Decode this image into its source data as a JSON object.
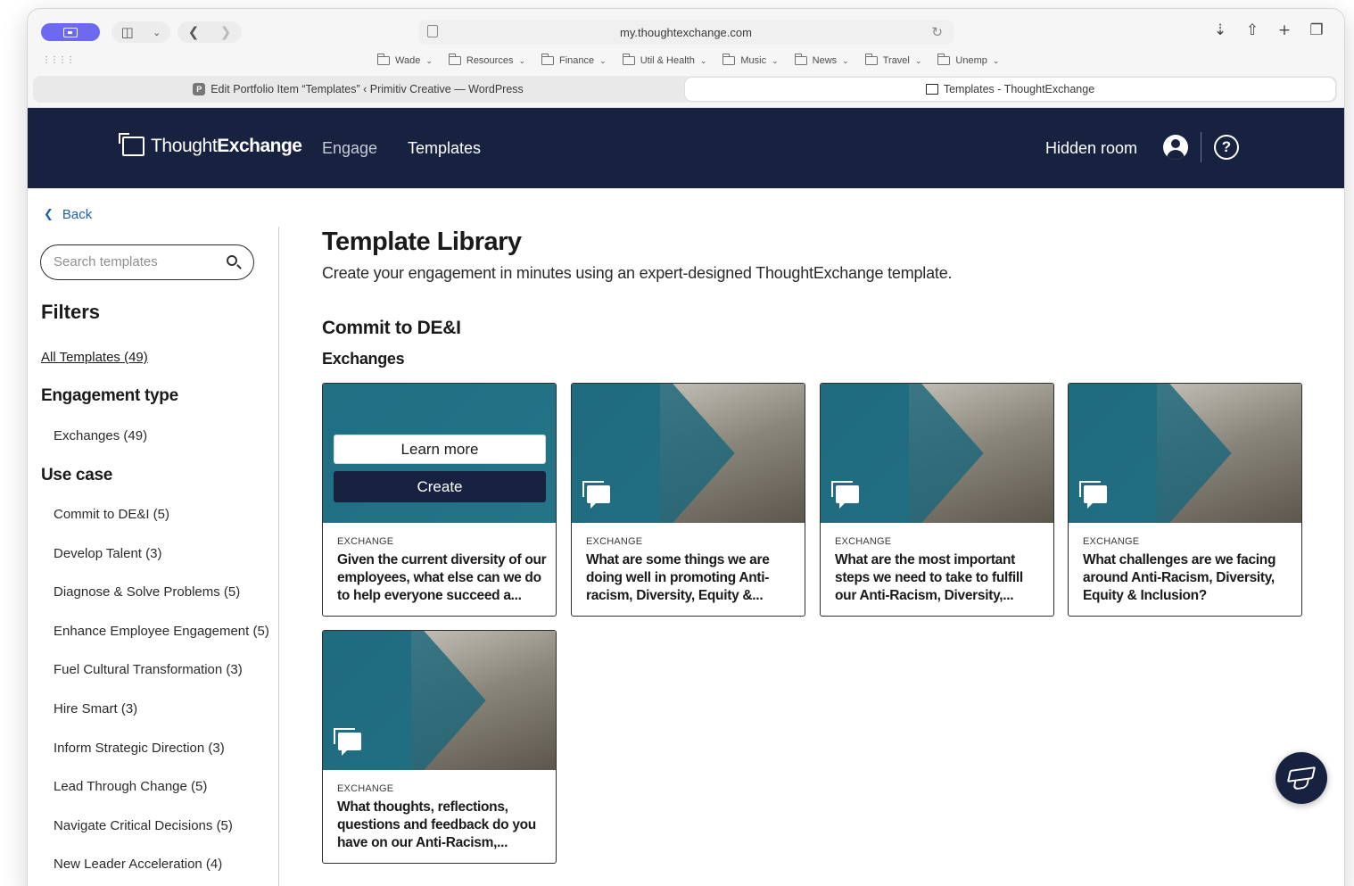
{
  "browser": {
    "url": "my.thoughtexchange.com",
    "bookmarks": [
      "Wade",
      "Resources",
      "Finance",
      "Util & Health",
      "Music",
      "News",
      "Travel",
      "Unemp"
    ],
    "tabs": [
      {
        "title": "Edit Portfolio Item “Templates” ‹ Primitiv Creative — WordPress",
        "favicon": "P"
      },
      {
        "title": "Templates - ThoughtExchange",
        "favicon": ""
      }
    ]
  },
  "header": {
    "logo_thin": "Thought",
    "logo_bold": "Exchange",
    "nav_engage": "Engage",
    "nav_templates": "Templates",
    "room": "Hidden room",
    "help": "?"
  },
  "sidebar": {
    "back": "Back",
    "search_placeholder": "Search templates",
    "filters_title": "Filters",
    "all_templates": "All Templates (49)",
    "engagement_type_title": "Engagement type",
    "engagement_types": [
      "Exchanges (49)"
    ],
    "use_case_title": "Use case",
    "use_cases": [
      "Commit to DE&I  (5)",
      "Develop Talent  (3)",
      "Diagnose & Solve Problems  (5)",
      "Enhance Employee Engagement  (5)",
      "Fuel Cultural Transformation  (3)",
      "Hire Smart  (3)",
      "Inform Strategic Direction  (3)",
      "Lead Through Change  (5)",
      "Navigate Critical Decisions  (5)",
      "New Leader Acceleration  (4)"
    ]
  },
  "main": {
    "title": "Template Library",
    "subtitle": "Create your engagement in minutes using an expert-designed ThoughtExchange template.",
    "section_title": "Commit to DE&I",
    "section_subtitle": "Exchanges",
    "learn_more": "Learn more",
    "create": "Create",
    "cards": [
      {
        "kind": "EXCHANGE",
        "question": "Given the current diversity of our employees, what else can we do to help everyone succeed a..."
      },
      {
        "kind": "EXCHANGE",
        "question": "What are some things we are doing well in promoting Anti-racism, Diversity, Equity &..."
      },
      {
        "kind": "EXCHANGE",
        "question": "What are the most important steps we need to take to fulfill our Anti-Racism, Diversity,..."
      },
      {
        "kind": "EXCHANGE",
        "question": "What challenges are we facing around Anti-Racism, Diversity, Equity & Inclusion?"
      },
      {
        "kind": "EXCHANGE",
        "question": "What thoughts, reflections, questions and feedback do you have on our Anti-Racism,..."
      }
    ]
  },
  "icons": {
    "sidebar_toggle": "sidebar-icon",
    "card_badge": "chat-bubbles-icon",
    "fab": "graduation-cap-icon"
  },
  "colors": {
    "navy": "#172240",
    "link": "#1f5fa8",
    "teal": "#2f7d93"
  }
}
